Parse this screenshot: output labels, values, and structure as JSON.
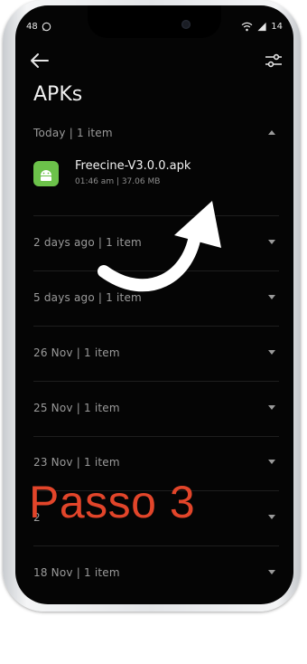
{
  "status": {
    "time": "48",
    "battery": "14"
  },
  "header": {
    "title": "APKs"
  },
  "groups": [
    {
      "label": "Today | 1 item",
      "expanded": true
    },
    {
      "label": "2 days ago | 1 item"
    },
    {
      "label": "5 days ago | 1 item"
    },
    {
      "label": "26 Nov | 1 item"
    },
    {
      "label": "25 Nov | 1 item"
    },
    {
      "label": "23 Nov | 1 item"
    },
    {
      "label": "2"
    },
    {
      "label": "18 Nov | 1 item"
    }
  ],
  "file": {
    "name": "Freecine-V3.0.0.apk",
    "meta": "01:46 am | 37.06 MB",
    "icon": "android-icon"
  },
  "overlay": {
    "text": "Passo 3",
    "color": "#e2452a"
  }
}
